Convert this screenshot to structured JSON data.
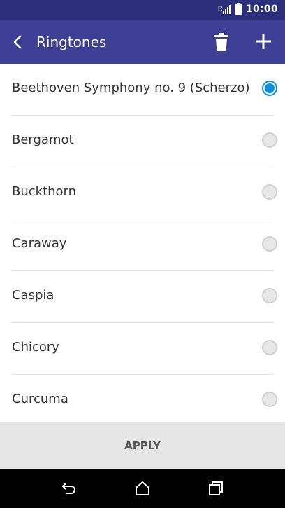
{
  "status_bar": {
    "time": "10:00",
    "icons": [
      "signal-icon",
      "battery-icon"
    ]
  },
  "app_bar": {
    "title": "Ringtones",
    "icons": [
      "back-arrow-icon",
      "trash-icon",
      "plus-icon"
    ]
  },
  "ringtones": [
    {
      "label": "Beethoven Symphony no. 9 (Scherzo)",
      "selected": true
    },
    {
      "label": "Bergamot",
      "selected": false
    },
    {
      "label": "Buckthorn",
      "selected": false
    },
    {
      "label": "Caraway",
      "selected": false
    },
    {
      "label": "Caspia",
      "selected": false
    },
    {
      "label": "Chicory",
      "selected": false
    },
    {
      "label": "Curcuma",
      "selected": false
    }
  ],
  "footer": {
    "apply_label": "APPLY"
  },
  "nav": {
    "icons": [
      "back-icon",
      "home-icon",
      "recents-icon"
    ]
  },
  "colors": {
    "status_bar": "#2b2e7a",
    "app_bar": "#3d3f95",
    "accent": "#0a8fe3"
  }
}
